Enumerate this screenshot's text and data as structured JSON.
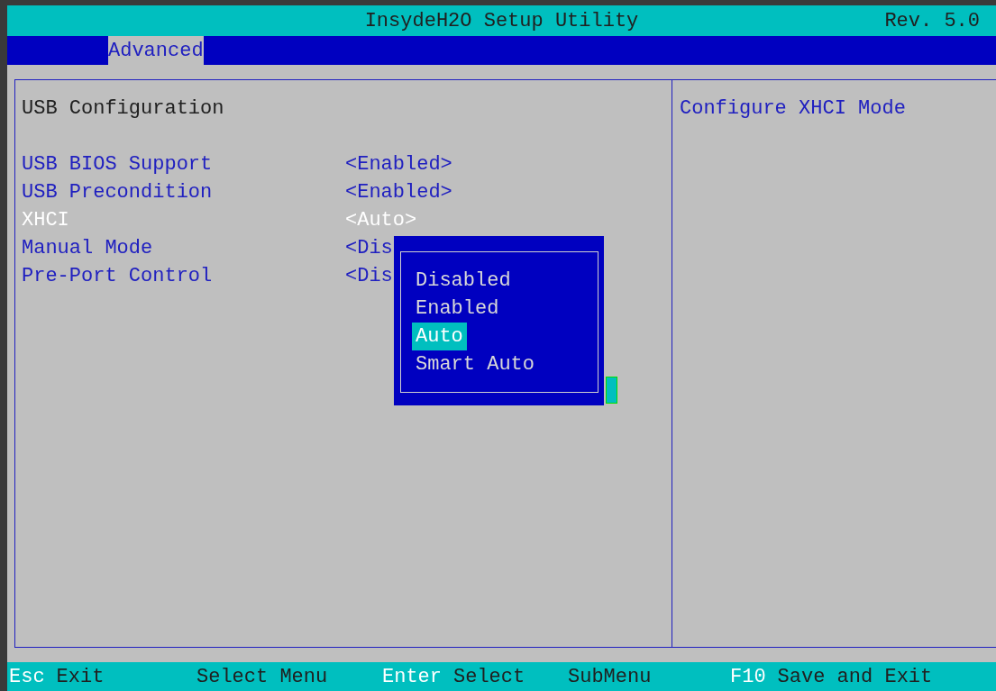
{
  "window": {
    "title": "InsydeH2O Setup Utility",
    "revision": "Rev. 5.0"
  },
  "tabs": [
    {
      "label": "Advanced",
      "selected": true
    }
  ],
  "page": {
    "heading": "USB Configuration",
    "settings": [
      {
        "label": "USB BIOS Support",
        "value": "<Enabled>",
        "selected": false
      },
      {
        "label": "USB Precondition",
        "value": "<Enabled>",
        "selected": false
      },
      {
        "label": "XHCI",
        "value": "<Auto>",
        "selected": true
      },
      {
        "label": "Manual Mode",
        "value": "<Dis",
        "selected": false
      },
      {
        "label": "Pre-Port Control",
        "value": "<Dis",
        "selected": false
      }
    ]
  },
  "help": {
    "text": "Configure XHCI Mode"
  },
  "popup": {
    "options": [
      {
        "label": "Disabled",
        "selected": false
      },
      {
        "label": "Enabled",
        "selected": false
      },
      {
        "label": "Auto",
        "selected": true
      },
      {
        "label": "Smart Auto",
        "selected": false
      }
    ]
  },
  "status_bar": [
    {
      "key": "Esc",
      "text": "Exit"
    },
    {
      "text": "Select Menu"
    },
    {
      "key": "Enter",
      "text": "Select"
    },
    {
      "text": "SubMenu"
    },
    {
      "key": "F10",
      "text": "Save and Exit"
    }
  ]
}
